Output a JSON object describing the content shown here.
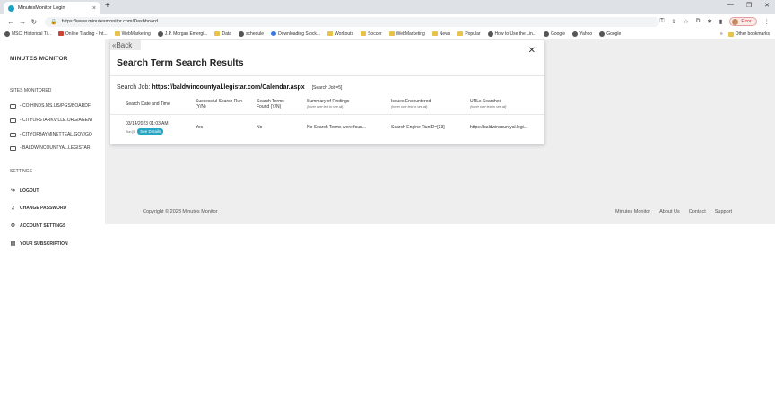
{
  "browser": {
    "tab_title": "MinutesMonitor Login",
    "tab_close": "×",
    "new_tab": "+",
    "window_controls": [
      "—",
      "❐",
      "✕"
    ],
    "url": "https://www.minutesmonitor.com/Dashboard",
    "profile_label": "Error",
    "bookmarks": [
      {
        "label": "MSCI Historical Ti...",
        "icon": "globe-icon"
      },
      {
        "label": "Online Trading - Int...",
        "icon": "red-square-icon"
      },
      {
        "label": "WebMarketing",
        "icon": "folder-icon"
      },
      {
        "label": "J.P. Morgan Emergi...",
        "icon": "globe-icon"
      },
      {
        "label": "Data",
        "icon": "folder-icon"
      },
      {
        "label": "schedule",
        "icon": "globe-icon"
      },
      {
        "label": "Downloading Stock...",
        "icon": "wordpress-icon"
      },
      {
        "label": "Workouts",
        "icon": "folder-icon"
      },
      {
        "label": "Soccer",
        "icon": "folder-icon"
      },
      {
        "label": "WebMarketing",
        "icon": "folder-icon"
      },
      {
        "label": "News",
        "icon": "folder-icon"
      },
      {
        "label": "Popular",
        "icon": "folder-icon"
      },
      {
        "label": "How to Use the Lin...",
        "icon": "globe-icon"
      },
      {
        "label": "Google",
        "icon": "globe-icon"
      },
      {
        "label": "Yahoo",
        "icon": "globe-icon"
      },
      {
        "label": "Google",
        "icon": "globe-icon"
      }
    ],
    "bookmarks_overflow": "»",
    "other_bookmarks": "Other bookmarks"
  },
  "sidebar": {
    "brand": "MINUTES MONITOR",
    "sites_title": "SITES MONITORED",
    "sites": [
      "- CO.HINDS.MS.US/PGS/BOARDF",
      "- CITYOFSTARKVILLE.ORG/AGENI",
      "- CITYOFBAYMINETTEAL.GOV/GO",
      "- BALDWINCOUNTYAL.LEGISTAR"
    ],
    "settings_title": "SETTINGS",
    "settings": [
      {
        "label": "LOGOUT",
        "icon": "logout-icon"
      },
      {
        "label": "CHANGE PASSWORD",
        "icon": "key-icon"
      },
      {
        "label": "ACCOUNT SETTINGS",
        "icon": "gear-icon"
      },
      {
        "label": "YOUR SUBSCRIPTION",
        "icon": "document-icon"
      }
    ]
  },
  "modal": {
    "back_label": "Back",
    "close_label": "✕",
    "title": "Search Term Search Results",
    "job_prefix": "Search Job:",
    "job_url": "https://baldwincountyal.legistar.com/Calendar.aspx",
    "job_id": "[Search Job=5]",
    "columns": [
      {
        "label": "Search Date and Time",
        "sub": ""
      },
      {
        "label": "Successful Search Run (Y/N)",
        "sub": ""
      },
      {
        "label": "Search Terms Found (Y/N)",
        "sub": ""
      },
      {
        "label": "Summary of Findings",
        "sub": "(hover over text to see all)"
      },
      {
        "label": "Issues Encountered",
        "sub": "(hover over text to see all)"
      },
      {
        "label": "URLs Searched",
        "sub": "(hover over text to see all)"
      }
    ],
    "rows": [
      {
        "date": "03/14/2023 01:03 AM",
        "run": "Run [9]",
        "details_label": "See Details",
        "success": "Yes",
        "found": "No",
        "summary": "No Search Terms were foun...",
        "issues": "Search Engine RunID=[33]",
        "urls": "https://baldwincountyal.legi..."
      }
    ]
  },
  "footer": {
    "copyright": "Copyright © 2023 Minutes Monitor",
    "links": [
      "Minutes Monitor",
      "About Us",
      "Contact",
      "Support"
    ]
  }
}
